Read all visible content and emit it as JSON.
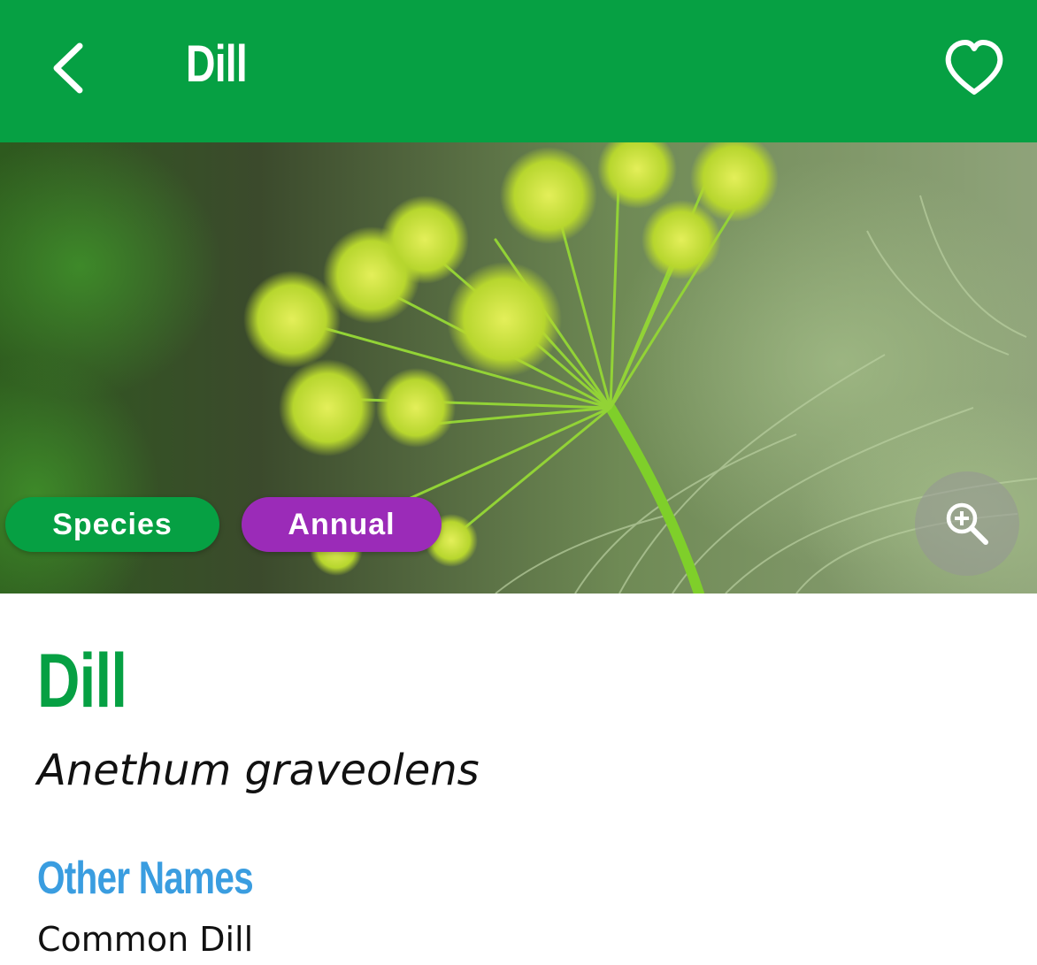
{
  "app": {
    "accent_color": "#06a043",
    "annual_color": "#9b2bb8",
    "section_heading_color": "#3a9de0"
  },
  "header": {
    "title": "Dill",
    "back_icon": "chevron-left-icon",
    "favorite_icon": "heart-outline-icon"
  },
  "hero": {
    "image_subject": "dill flower umbel photo",
    "tags": [
      {
        "label": "Species"
      },
      {
        "label": "Annual"
      }
    ],
    "zoom_icon": "zoom-in-icon"
  },
  "plant": {
    "common_name": "Dill",
    "scientific_name": "Anethum graveolens",
    "other_names_heading": "Other Names",
    "other_names": [
      "Common Dill"
    ]
  }
}
